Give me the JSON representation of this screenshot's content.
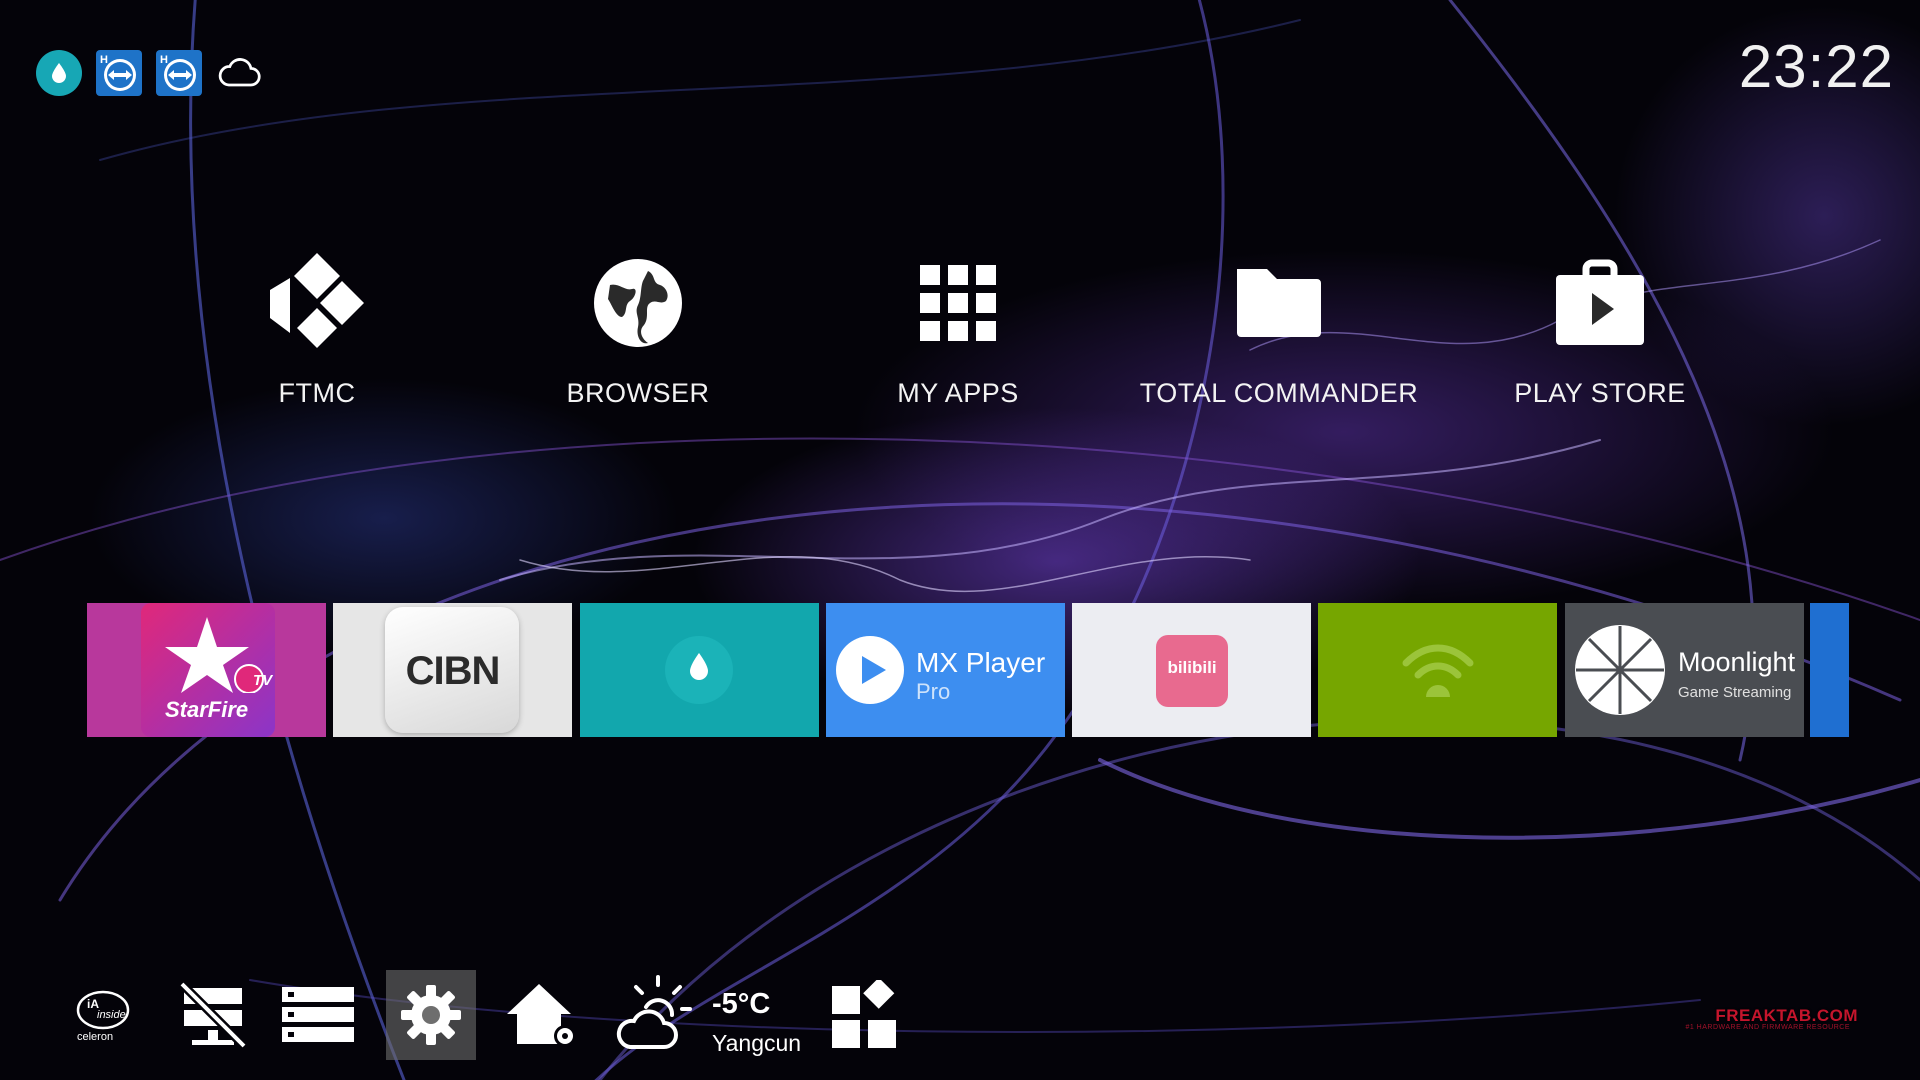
{
  "status_bar": {
    "icons": [
      "water-drop-icon",
      "teamviewer-icon",
      "teamviewer-icon",
      "cloud-icon"
    ],
    "clock": "23:22"
  },
  "shortcuts": [
    {
      "label": "FTMC",
      "icon": "kodi-icon"
    },
    {
      "label": "BROWSER",
      "icon": "globe-icon"
    },
    {
      "label": "MY APPS",
      "icon": "apps-grid-icon"
    },
    {
      "label": "TOTAL COMMANDER",
      "icon": "folder-icon"
    },
    {
      "label": "PLAY STORE",
      "icon": "play-store-icon"
    }
  ],
  "tiles": [
    {
      "name": "starfire",
      "logo_text": "StarFire",
      "badge": "TV",
      "bg": "#b8389c"
    },
    {
      "name": "cibn",
      "logo_text": "CIBN",
      "bg": "#e6e6e6"
    },
    {
      "name": "water-drop-app",
      "bg": "#12a7ad"
    },
    {
      "name": "mx-player",
      "title": "MX Player",
      "subtitle": "Pro",
      "bg": "#3d8ef0"
    },
    {
      "name": "bilibili",
      "logo_text": "bilibili",
      "bg": "#ecedf2"
    },
    {
      "name": "nvidia-streaming",
      "bg": "#76a600"
    },
    {
      "name": "moonlight",
      "title": "Moonlight",
      "subtitle": "Game Streaming",
      "bg": "#4a4d52"
    }
  ],
  "dock": {
    "items": [
      "intel-celeron-icon",
      "network-off-icon",
      "storage-icon",
      "settings-icon",
      "home-settings-icon",
      "weather-icon",
      "widgets-icon"
    ],
    "cpu_badge": {
      "brand": "iA",
      "inside": "inside",
      "chip": "celeron"
    },
    "weather": {
      "temp": "-5°C",
      "city": "Yangcun"
    }
  },
  "watermark": {
    "main": "FREAKTAB.COM",
    "sub": "#1 HARDWARE AND FIRMWARE RESOURCE"
  },
  "colors": {
    "teal": "#17a7b5",
    "teamviewer": "#1e73c8",
    "selected_dock": "#6e6e6e"
  }
}
